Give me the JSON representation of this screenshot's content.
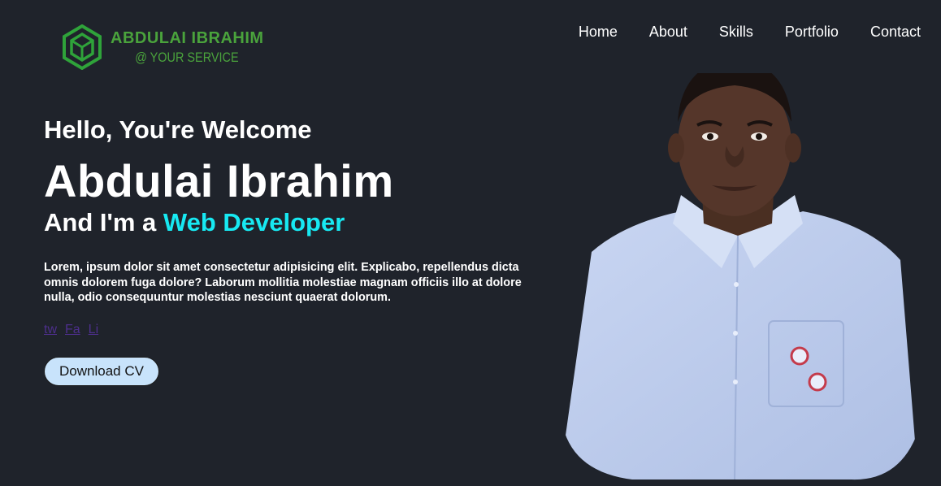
{
  "logo": {
    "name": "ABDULAI IBRAHIM",
    "tagline": "@ YOUR SERVICE",
    "icon": "hexagon-cube-logo",
    "color": "#4aa33c"
  },
  "nav": {
    "items": [
      "Home",
      "About",
      "Skills",
      "Portfolio",
      "Contact"
    ]
  },
  "hero": {
    "greeting": "Hello, You're Welcome",
    "name": "Abdulai Ibrahim",
    "role_prefix": "And I'm a ",
    "role": "Web Developer",
    "description": "Lorem, ipsum dolor sit amet consectetur adipisicing elit. Explicabo, repellendus dicta omnis dolorem fuga dolore? Laborum mollitia molestiae magnam officiis illo at dolore nulla, odio consequuntur molestias nesciunt quaerat dolorum.",
    "socials": [
      "tw",
      "Fa",
      "Li"
    ],
    "cv_button": "Download CV"
  },
  "colors": {
    "background": "#1f232b",
    "accent": "#17e9f2",
    "button_bg": "#c8e3fb",
    "link": "#4d2f8c"
  },
  "portrait": {
    "subject": "person-portrait"
  }
}
